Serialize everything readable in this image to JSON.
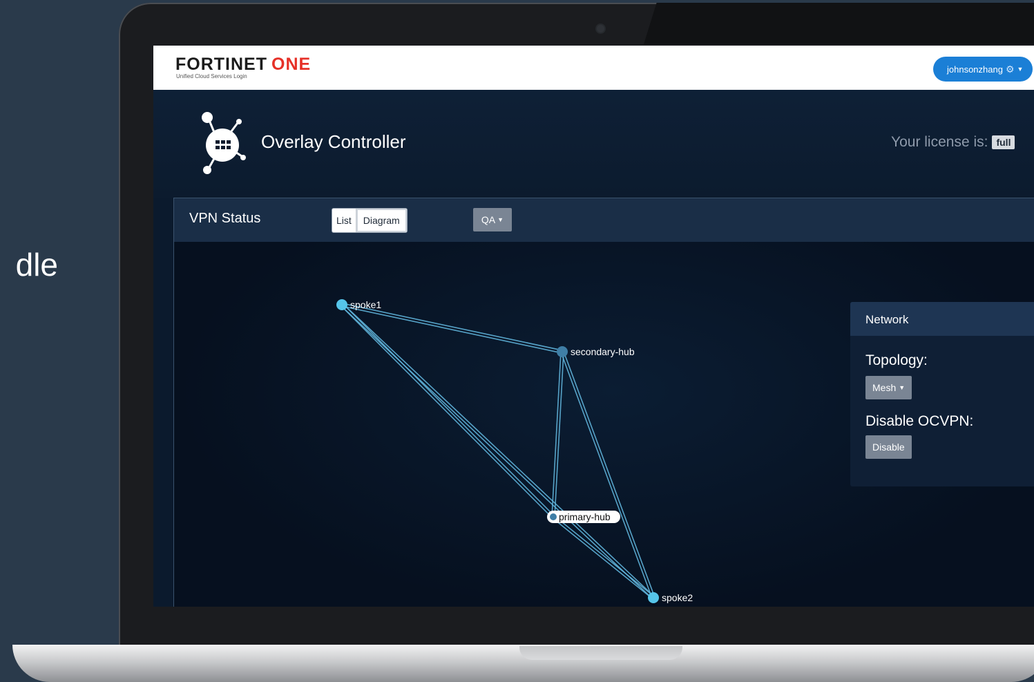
{
  "slide": {
    "partial_text": "dle"
  },
  "topbar": {
    "logo_main": "FORTINET",
    "logo_accent": "ONE",
    "logo_sub": "Unified Cloud Services Login",
    "user": "johnsonzhang",
    "user_icon": "gear-icon"
  },
  "header": {
    "app_title": "Overlay Controller",
    "license_label": "Your license is:",
    "license_value": "full"
  },
  "panel": {
    "title": "VPN Status",
    "view_tabs": [
      {
        "label": "List",
        "active": false
      },
      {
        "label": "Diagram",
        "active": true
      }
    ],
    "group_selector": "QA"
  },
  "diagram": {
    "nodes": [
      {
        "id": "spoke1",
        "label": "spoke1"
      },
      {
        "id": "secondary-hub",
        "label": "secondary-hub"
      },
      {
        "id": "primary-hub",
        "label": "primary-hub"
      },
      {
        "id": "spoke2",
        "label": "spoke2"
      }
    ],
    "links": [
      [
        "spoke1",
        "secondary-hub"
      ],
      [
        "spoke1",
        "primary-hub"
      ],
      [
        "spoke1",
        "spoke2"
      ],
      [
        "secondary-hub",
        "primary-hub"
      ],
      [
        "secondary-hub",
        "spoke2"
      ],
      [
        "primary-hub",
        "spoke2"
      ]
    ]
  },
  "network": {
    "title": "Network",
    "topology_label": "Topology:",
    "topology_value": "Mesh",
    "disable_label": "Disable OCVPN:",
    "disable_button": "Disable"
  },
  "colors": {
    "accent_blue": "#1b7fd6",
    "link": "#5fb3d9",
    "node_spoke": "#56c5ea",
    "node_hub": "#3f7ea6",
    "brand_red": "#e63027"
  }
}
